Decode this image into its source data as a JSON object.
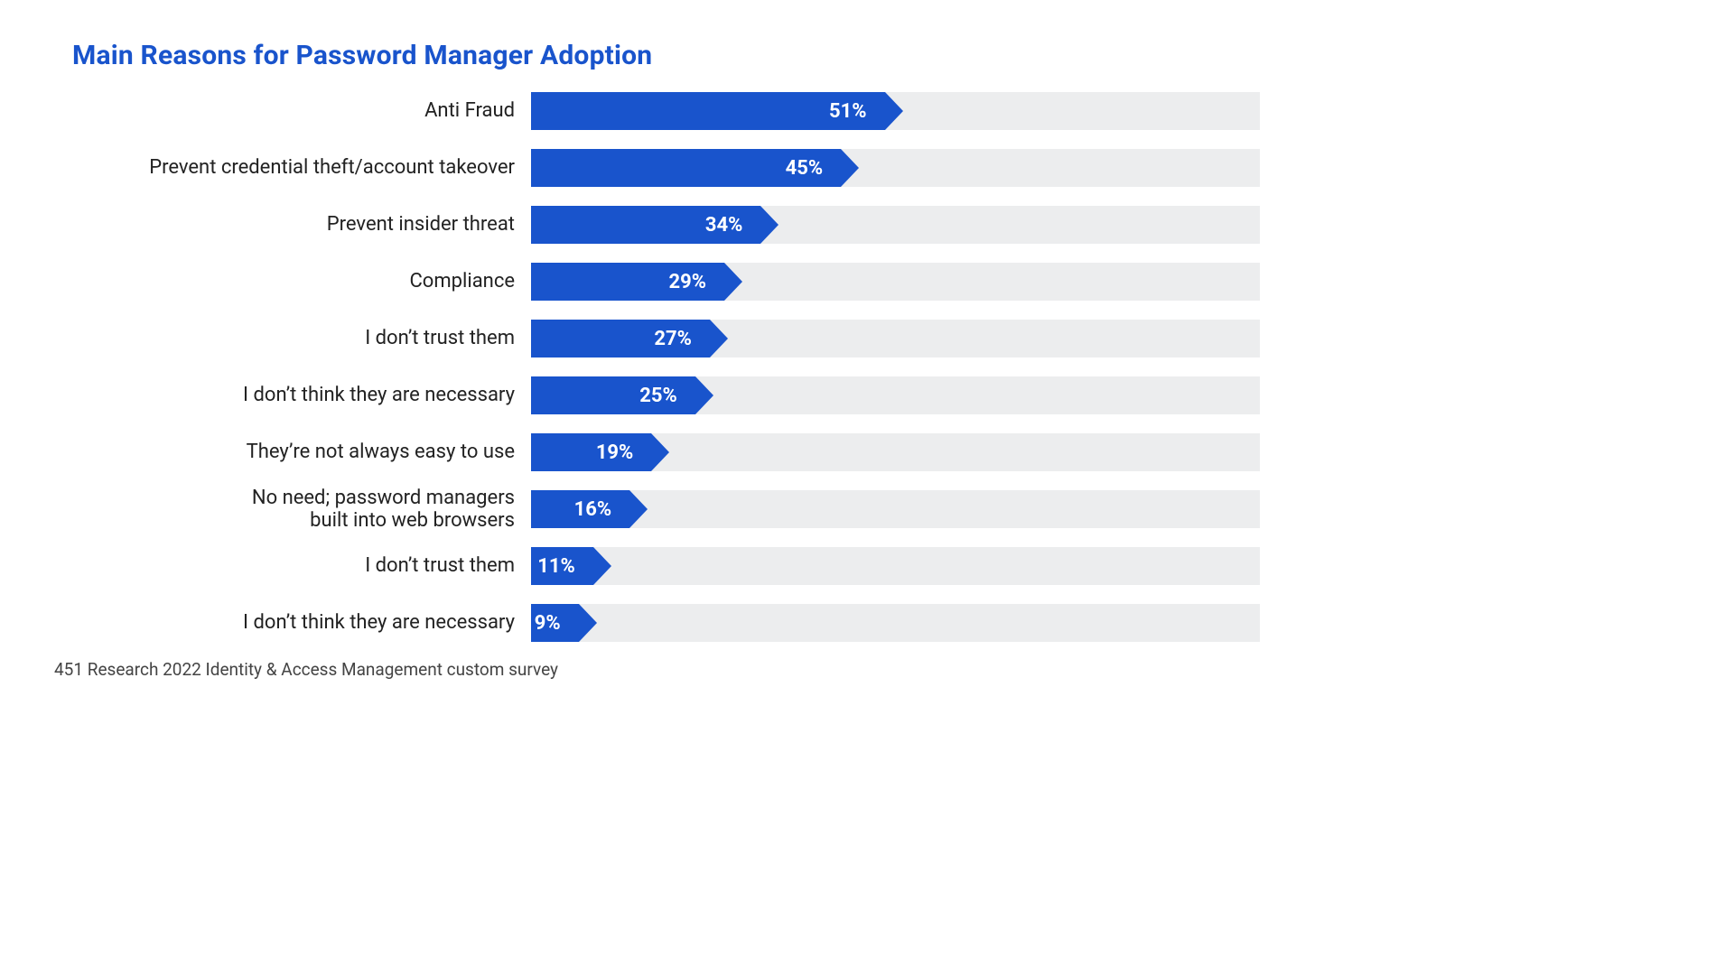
{
  "title": "Main Reasons for Password Manager Adoption",
  "source": "451 Research 2022 Identity & Access Management custom survey",
  "colors": {
    "bar": "#1954cc",
    "track": "#ecedee",
    "title": "#1954cc"
  },
  "chart_data": {
    "type": "bar",
    "orientation": "horizontal",
    "xlim": [
      0,
      100
    ],
    "xlabel": "",
    "ylabel": "",
    "categories": [
      "Anti Fraud",
      "Prevent credential theft/account takeover",
      "Prevent insider threat",
      "Compliance",
      "I don’t trust them",
      "I don’t think they are necessary",
      "They’re not always easy to use",
      "No need; password managers built into web browsers",
      "I don’t trust them",
      "I don’t think they are necessary"
    ],
    "values": [
      51,
      45,
      34,
      29,
      27,
      25,
      19,
      16,
      11,
      9
    ],
    "value_labels": [
      "51%",
      "45%",
      "34%",
      "29%",
      "27%",
      "25%",
      "19%",
      "16%",
      "11%",
      "9%"
    ],
    "title": "Main Reasons for Password Manager Adoption"
  }
}
